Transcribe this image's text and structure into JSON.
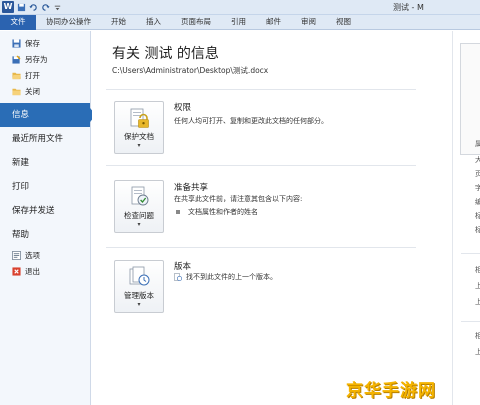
{
  "window": {
    "title": "测试 - M",
    "qat_icons": [
      "word-logo-icon",
      "save-icon",
      "undo-icon",
      "redo-icon",
      "customize-icon"
    ],
    "logo_letter": "W"
  },
  "tabs": [
    {
      "label": "文件"
    },
    {
      "label": "协同办公操作"
    },
    {
      "label": "开始"
    },
    {
      "label": "插入"
    },
    {
      "label": "页面布局"
    },
    {
      "label": "引用"
    },
    {
      "label": "邮件"
    },
    {
      "label": "审阅"
    },
    {
      "label": "视图"
    }
  ],
  "nav": {
    "small_items": [
      {
        "label": "保存",
        "icon": "save-icon"
      },
      {
        "label": "另存为",
        "icon": "save-as-icon"
      },
      {
        "label": "打开",
        "icon": "open-folder-icon"
      },
      {
        "label": "关闭",
        "icon": "close-folder-icon"
      }
    ],
    "big_items": [
      {
        "label": "信息"
      },
      {
        "label": "最近所用文件"
      },
      {
        "label": "新建"
      },
      {
        "label": "打印"
      },
      {
        "label": "保存并发送"
      },
      {
        "label": "帮助"
      }
    ],
    "bottom_items": [
      {
        "label": "选项",
        "icon": "options-icon"
      },
      {
        "label": "退出",
        "icon": "exit-icon"
      }
    ]
  },
  "main": {
    "title": "有关 测试 的信息",
    "path": "C:\\Users\\Administrator\\Desktop\\测试.docx",
    "sections": [
      {
        "button_label": "保护文档",
        "caret": "▾",
        "icon": "lock-key-icon",
        "heading": "权限",
        "text": "任何人均可打开、复制和更改此文档的任何部分。"
      },
      {
        "button_label": "检查问题",
        "caret": "▾",
        "icon": "check-document-icon",
        "heading": "准备共享",
        "text": "在共享此文件前，请注意其包含以下内容:",
        "bullet": "文档属性和作者的姓名"
      },
      {
        "button_label": "管理版本",
        "caret": "▾",
        "icon": "manage-versions-icon",
        "heading": "版本",
        "text": "找不到此文件的上一个版本。"
      }
    ]
  },
  "right": {
    "items": [
      "属",
      "大",
      "页",
      "字",
      "编",
      "标",
      "标",
      "相",
      "上",
      "上",
      "相",
      "上"
    ]
  },
  "watermark": {
    "text": "京华手游网"
  },
  "colors": {
    "file_tab": "#2b63b0",
    "nav_active": "#2a6db6",
    "watermark": "#f5b400"
  }
}
